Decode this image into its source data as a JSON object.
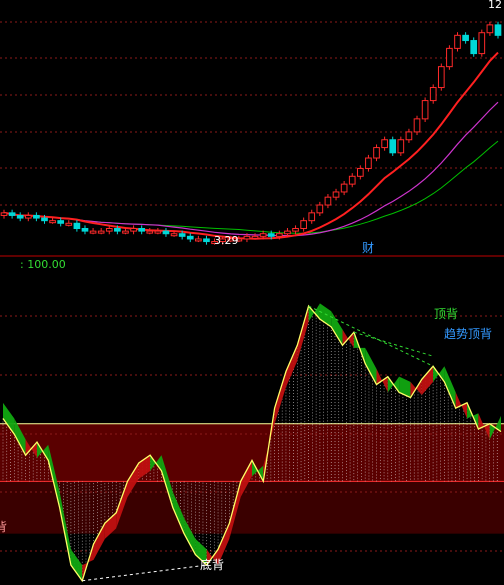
{
  "colors": {
    "background": "#000000",
    "grid": "#8c1a1a",
    "candle_up": "#ff2a2a",
    "candle_down": "#00d8d8",
    "ma_fast": "#ff2020",
    "ma_slow": "#cc33cc",
    "ma_flat": "#00c000",
    "divider": "#c00000",
    "band_upper": "#5a0000",
    "band_lower": "#3a0000",
    "ref_line": "#ffff99",
    "osc_line": "#ffff66",
    "fill_bull": "#c01010",
    "fill_bear": "#11a811",
    "annot_green": "#33dd33",
    "annot_blue": "#3399ff",
    "white": "#ffffff"
  },
  "chart_data": [
    {
      "type": "candlestick",
      "panel": "price",
      "annotations": {
        "low_price": "3.29",
        "high_price": "12",
        "marker": "财"
      },
      "x": [
        0,
        1,
        2,
        3,
        4,
        5,
        6,
        7,
        8,
        9,
        10,
        11,
        12,
        13,
        14,
        15,
        16,
        17,
        18,
        19,
        20,
        21,
        22,
        23,
        24,
        25,
        26,
        27,
        28,
        29,
        30,
        31,
        32,
        33,
        34,
        35,
        36,
        37,
        38,
        39,
        40,
        41,
        42,
        43,
        44,
        45,
        46,
        47,
        48,
        49,
        50,
        51,
        52,
        53,
        54,
        55,
        56,
        57,
        58,
        59,
        60,
        61
      ],
      "open": [
        4.4,
        4.5,
        4.4,
        4.3,
        4.4,
        4.3,
        4.2,
        4.2,
        4.1,
        4.1,
        3.9,
        3.8,
        3.8,
        3.8,
        3.9,
        3.8,
        3.8,
        3.9,
        3.8,
        3.8,
        3.8,
        3.7,
        3.7,
        3.6,
        3.5,
        3.5,
        3.4,
        3.4,
        3.5,
        3.5,
        3.5,
        3.6,
        3.6,
        3.7,
        3.6,
        3.7,
        3.8,
        3.9,
        4.2,
        4.5,
        4.8,
        5.1,
        5.3,
        5.6,
        5.9,
        6.2,
        6.6,
        7.0,
        7.3,
        6.8,
        7.3,
        7.6,
        8.1,
        8.8,
        9.3,
        10.1,
        10.8,
        11.3,
        11.1,
        10.6,
        11.4,
        11.7
      ],
      "close": [
        4.5,
        4.4,
        4.3,
        4.4,
        4.3,
        4.2,
        4.2,
        4.1,
        4.1,
        3.9,
        3.8,
        3.8,
        3.8,
        3.9,
        3.8,
        3.8,
        3.9,
        3.8,
        3.8,
        3.8,
        3.7,
        3.7,
        3.6,
        3.5,
        3.5,
        3.4,
        3.4,
        3.5,
        3.5,
        3.5,
        3.6,
        3.6,
        3.7,
        3.6,
        3.7,
        3.8,
        3.9,
        4.2,
        4.5,
        4.8,
        5.1,
        5.3,
        5.6,
        5.9,
        6.2,
        6.6,
        7.0,
        7.3,
        6.8,
        7.3,
        7.6,
        8.1,
        8.8,
        9.3,
        10.1,
        10.8,
        11.3,
        11.1,
        10.6,
        11.4,
        11.7,
        11.3
      ],
      "ylim": [
        3.0,
        12.5
      ]
    },
    {
      "type": "line",
      "panel": "oscillator",
      "scale_label": ": 100.00",
      "reference_levels": [
        100,
        60,
        38,
        18
      ],
      "ylim": [
        -2,
        118
      ],
      "series": [
        {
          "values": [
            62,
            56,
            48,
            53,
            46,
            28,
            6,
            0,
            14,
            22,
            26,
            38,
            45,
            48,
            42,
            28,
            18,
            10,
            6,
            12,
            22,
            38,
            46,
            38,
            66,
            80,
            90,
            105,
            100,
            97,
            90,
            95,
            83,
            75,
            78,
            72,
            70,
            77,
            82,
            76,
            66,
            68,
            58,
            60,
            57
          ]
        }
      ],
      "annotations": {
        "top_divergence": "顶背",
        "trend_top_divergence": "趋势顶背",
        "bottom_divergence": "底背",
        "edge_text": "背"
      }
    }
  ]
}
